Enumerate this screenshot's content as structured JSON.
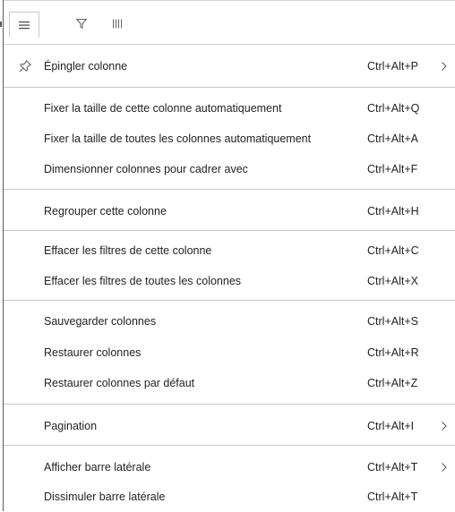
{
  "tabs": {
    "general_icon": "hamburger-icon",
    "filter_icon": "funnel-icon",
    "columns_icon": "columns-icon"
  },
  "menu": {
    "pin_column": {
      "label": "Épingler colonne",
      "shortcut": "Ctrl+Alt+P"
    },
    "autosize_this": {
      "label": "Fixer la taille de cette colonne automatiquement",
      "shortcut": "Ctrl+Alt+Q"
    },
    "autosize_all": {
      "label": "Fixer la taille de toutes les colonnes automatiquement",
      "shortcut": "Ctrl+Alt+A"
    },
    "size_to_fit": {
      "label": "Dimensionner colonnes pour cadrer avec",
      "shortcut": "Ctrl+Alt+F"
    },
    "group_column": {
      "label": "Regrouper cette colonne",
      "shortcut": "Ctrl+Alt+H"
    },
    "clear_filters_this": {
      "label": "Effacer les filtres de cette colonne",
      "shortcut": "Ctrl+Alt+C"
    },
    "clear_filters_all": {
      "label": "Effacer les filtres de toutes les colonnes",
      "shortcut": "Ctrl+Alt+X"
    },
    "save_columns": {
      "label": "Sauvegarder colonnes",
      "shortcut": "Ctrl+Alt+S"
    },
    "restore_columns": {
      "label": "Restaurer colonnes",
      "shortcut": "Ctrl+Alt+R"
    },
    "restore_default": {
      "label": "Restaurer colonnes par défaut",
      "shortcut": "Ctrl+Alt+Z"
    },
    "pagination": {
      "label": "Pagination",
      "shortcut": "Ctrl+Alt+I"
    },
    "show_sidebar": {
      "label": "Afficher barre latérale",
      "shortcut": "Ctrl+Alt+T"
    },
    "hide_sidebar": {
      "label": "Dissimuler barre latérale",
      "shortcut": "Ctrl+Alt+T"
    }
  },
  "colors": {
    "separator": "#c8c8c8",
    "text": "#222222",
    "icon": "#555555"
  }
}
